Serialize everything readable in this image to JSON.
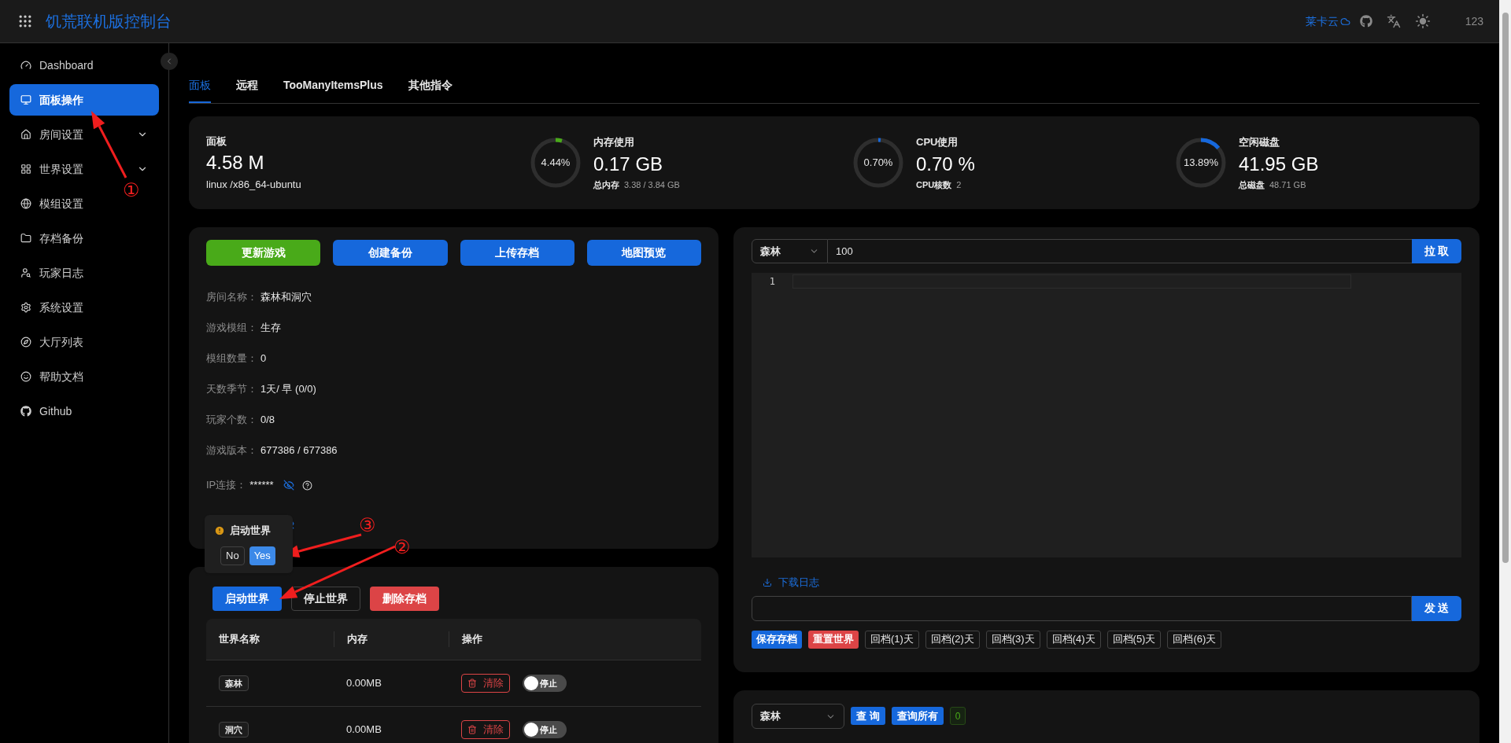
{
  "header": {
    "title": "饥荒联机版控制台",
    "link": "莱卡云",
    "user": "123"
  },
  "sidebar": {
    "items": [
      {
        "label": "Dashboard",
        "selected": false
      },
      {
        "label": "面板操作",
        "selected": true
      },
      {
        "label": "房间设置",
        "selected": false,
        "expanded": false
      },
      {
        "label": "世界设置",
        "selected": false,
        "expanded": false
      },
      {
        "label": "模组设置",
        "selected": false
      },
      {
        "label": "存档备份",
        "selected": false
      },
      {
        "label": "玩家日志",
        "selected": false
      },
      {
        "label": "系统设置",
        "selected": false
      },
      {
        "label": "大厅列表",
        "selected": false
      },
      {
        "label": "帮助文档",
        "selected": false
      },
      {
        "label": "Github",
        "selected": false
      }
    ]
  },
  "tabs": [
    {
      "label": "面板",
      "selected": true
    },
    {
      "label": "远程",
      "selected": false
    },
    {
      "label": "TooManyItemsPlus",
      "selected": false
    },
    {
      "label": "其他指令",
      "selected": false
    }
  ],
  "stats": [
    {
      "kind": "plain",
      "title": "面板",
      "value": "4.58 M",
      "note": "linux /x86_64-ubuntu"
    },
    {
      "kind": "ring",
      "ring_text": "4.44%",
      "level": 0.0444,
      "color": "#49aa19",
      "title": "内存使用",
      "value": "0.17 GB",
      "note_label": "总内存",
      "note": "3.38 / 3.84 GB"
    },
    {
      "kind": "ring",
      "ring_text": "0.70%",
      "level": 0.007,
      "color": "#1668dc",
      "title": "CPU使用",
      "value": "0.70 %",
      "note_label": "CPU核数",
      "note": "2"
    },
    {
      "kind": "ring",
      "ring_text": "13.89%",
      "level": 0.1389,
      "color": "#1668dc",
      "title": "空闲磁盘",
      "value": "41.95 GB",
      "note_label": "总磁盘",
      "note": "48.71 GB"
    }
  ],
  "control_panel": {
    "buttons": [
      {
        "label": "更新游戏",
        "kind": "success"
      },
      {
        "label": "创建备份",
        "kind": "primary"
      },
      {
        "label": "上传存档",
        "kind": "primary"
      },
      {
        "label": "地图预览",
        "kind": "primary"
      }
    ],
    "info": [
      {
        "label": "房间名称：",
        "value": "森林和洞穴",
        "kind": "text"
      },
      {
        "label": "游戏模组：",
        "value": "生存",
        "kind": "text"
      },
      {
        "label": "模组数量：",
        "value": "0",
        "kind": "text"
      },
      {
        "label": "天数季节：",
        "value": "1天/ 早 (0/0)",
        "kind": "text"
      },
      {
        "label": "玩家个数：",
        "value": "0/8",
        "kind": "text"
      },
      {
        "label": "游戏版本：",
        "value": "677386 / 677386",
        "kind": "text"
      },
      {
        "label": "IP连接：",
        "value": "******",
        "kind": "secret_help"
      },
      {
        "kind": "secret"
      }
    ]
  },
  "confirm_popover": {
    "title": "启动世界",
    "buttons": [
      {
        "label": "No",
        "kind": "default"
      },
      {
        "label": "Yes",
        "kind": "primary"
      }
    ]
  },
  "worlds": {
    "buttons": [
      {
        "label": "启动世界",
        "kind": "primary"
      },
      {
        "label": "停止世界",
        "kind": "default"
      },
      {
        "label": "删除存档",
        "kind": "danger"
      }
    ],
    "columns": [
      "世界名称",
      "内存",
      "操作"
    ],
    "rows": [
      {
        "name": "森林",
        "memory": "0.00MB",
        "action": "清除",
        "switch_label": "停止",
        "on": false
      },
      {
        "name": "洞穴",
        "memory": "0.00MB",
        "action": "清除",
        "switch_label": "停止",
        "on": false
      }
    ]
  },
  "log_panel": {
    "world": "森林",
    "lines": "100",
    "fetch": "拉 取",
    "line_numbers": [
      "1"
    ],
    "download": "下载日志",
    "send": "发 送",
    "quick": [
      {
        "label": "保存存档",
        "kind": "primary"
      },
      {
        "label": "重置世界",
        "kind": "danger"
      },
      {
        "label": "回档(1)天",
        "kind": "default"
      },
      {
        "label": "回档(2)天",
        "kind": "default"
      },
      {
        "label": "回档(3)天",
        "kind": "default"
      },
      {
        "label": "回档(4)天",
        "kind": "default"
      },
      {
        "label": "回档(5)天",
        "kind": "default"
      },
      {
        "label": "回档(6)天",
        "kind": "default"
      }
    ]
  },
  "query_panel": {
    "world": "森林",
    "buttons": [
      "查 询",
      "查询所有"
    ],
    "count": "0"
  },
  "annotations": [
    {
      "label": "①"
    },
    {
      "label": "②"
    },
    {
      "label": "③"
    }
  ]
}
